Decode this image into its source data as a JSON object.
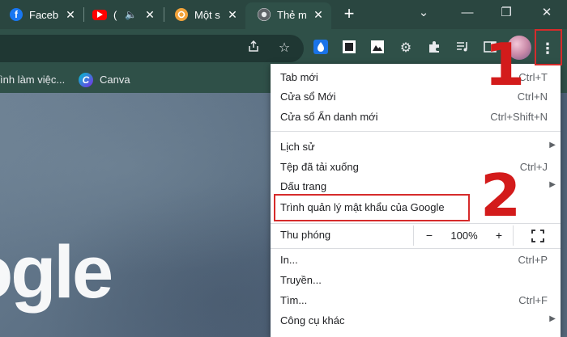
{
  "tabs": [
    {
      "label": "Faceb",
      "close": "✕"
    },
    {
      "label": "(",
      "close": "✕"
    },
    {
      "label": "Một s",
      "close": "✕"
    },
    {
      "label": "Thẻ m",
      "close": "✕"
    }
  ],
  "new_tab": "+",
  "window_controls": {
    "chevron": "⌄",
    "minimize": "—",
    "restore": "❐",
    "close": "✕"
  },
  "bookmarks": [
    {
      "label": "ình làm việc..."
    },
    {
      "label": "Canva"
    }
  ],
  "page": {
    "logo_fragment": "ogle"
  },
  "menu": {
    "new_tab": {
      "label": "Tab mới",
      "shortcut": "Ctrl+T"
    },
    "new_window": {
      "label": "Cửa sổ Mới",
      "shortcut": "Ctrl+N"
    },
    "incognito": {
      "label": "Cửa sổ Ẩn danh mới",
      "shortcut": "Ctrl+Shift+N"
    },
    "history": {
      "label": "Lịch sử"
    },
    "downloads": {
      "label": "Tệp đã tải xuống",
      "shortcut": "Ctrl+J"
    },
    "bookmarks": {
      "label": "Dấu trang"
    },
    "password_manager": {
      "label": "Trình quản lý mật khẩu của Google"
    },
    "zoom": {
      "label": "Thu phóng",
      "minus": "−",
      "value": "100%",
      "plus": "+"
    },
    "print": {
      "label": "In...",
      "shortcut": "Ctrl+P"
    },
    "cast": {
      "label": "Truyền..."
    },
    "find": {
      "label": "Tìm...",
      "shortcut": "Ctrl+F"
    },
    "more_tools": {
      "label": "Công cụ khác"
    }
  },
  "annotations": {
    "step1": "1",
    "step2": "2"
  },
  "colors": {
    "accent_red": "#d62b2b",
    "chrome_green": "#2f5048"
  }
}
